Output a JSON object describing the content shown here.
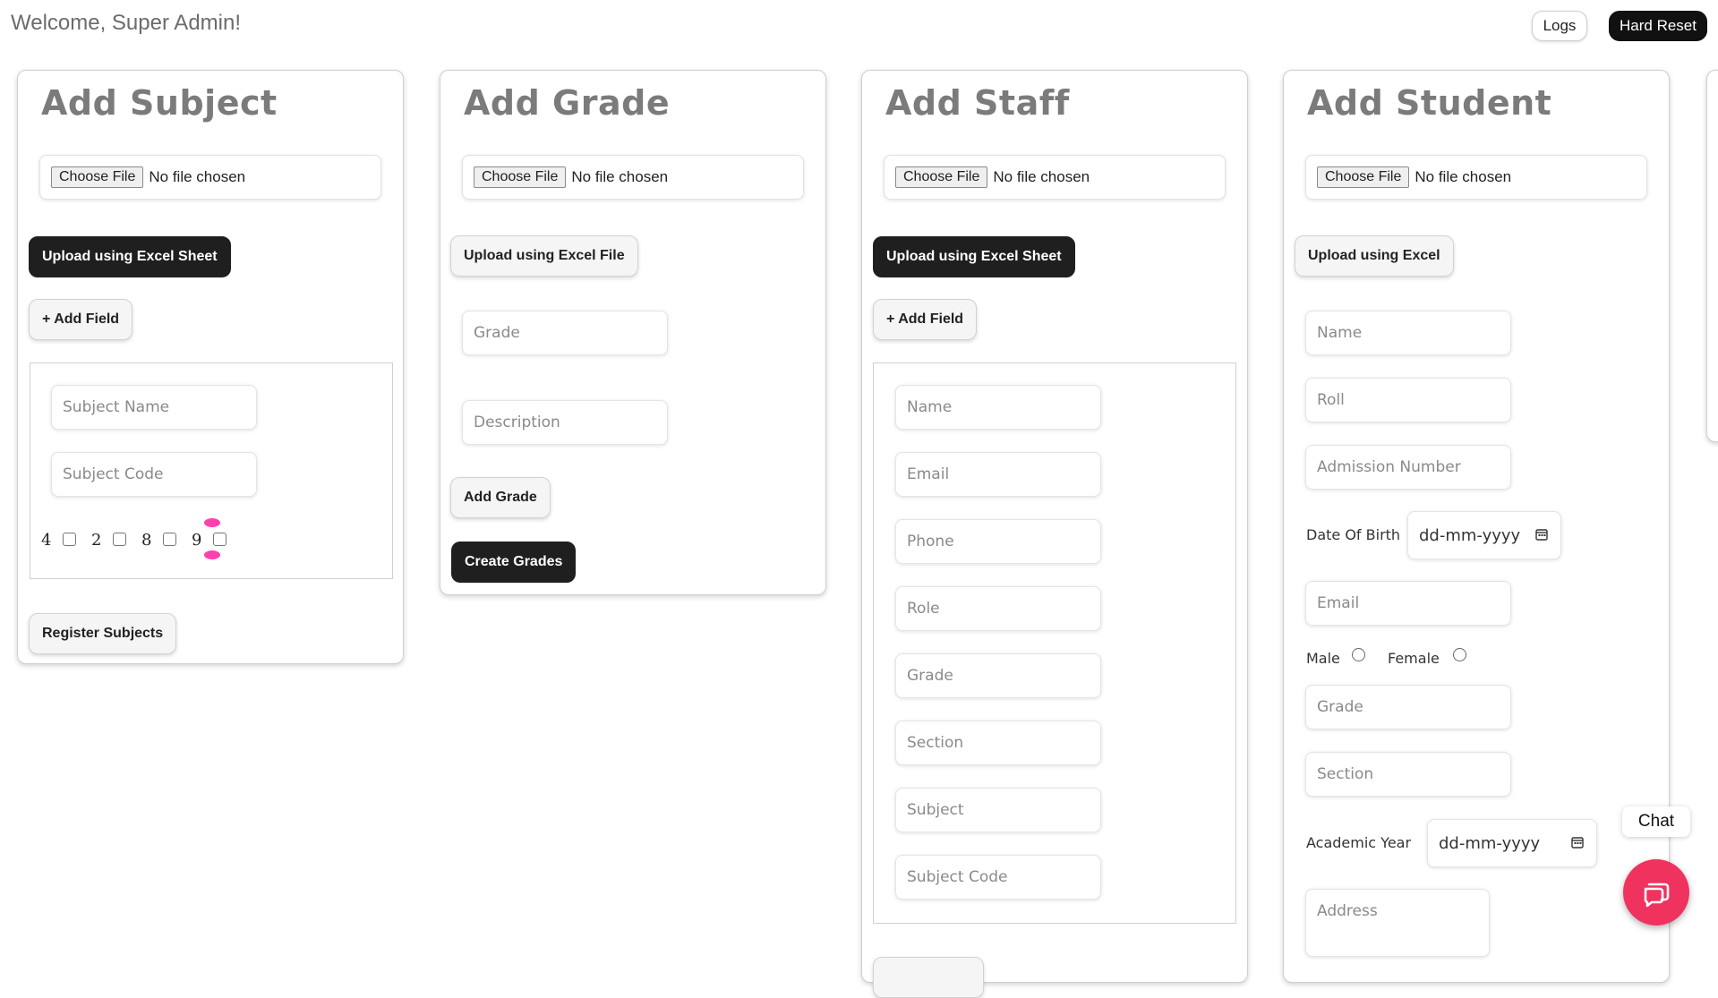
{
  "header": {
    "welcome": "Welcome, Super Admin!",
    "logs_label": "Logs",
    "hard_reset_label": "Hard Reset"
  },
  "file_input": {
    "choose_label": "Choose File",
    "no_file_label": "No file chosen"
  },
  "subject_card": {
    "title": "Add Subject",
    "upload_label": "Upload using Excel Sheet",
    "add_field_label": "+ Add Field",
    "subject_name_placeholder": "Subject Name",
    "subject_code_placeholder": "Subject Code",
    "grade_options": [
      "4",
      "2",
      "8",
      "9"
    ],
    "register_label": "Register Subjects"
  },
  "grade_card": {
    "title": "Add Grade",
    "upload_label": "Upload using Excel File",
    "grade_placeholder": "Grade",
    "description_placeholder": "Description",
    "add_grade_label": "Add Grade",
    "create_grades_label": "Create Grades"
  },
  "staff_card": {
    "title": "Add Staff",
    "upload_label": "Upload using Excel Sheet",
    "add_field_label": "+ Add Field",
    "fields": [
      "Name",
      "Email",
      "Phone",
      "Role",
      "Grade",
      "Section",
      "Subject",
      "Subject Code"
    ]
  },
  "student_card": {
    "title": "Add Student",
    "upload_label": "Upload using Excel",
    "name_placeholder": "Name",
    "roll_placeholder": "Roll",
    "admission_placeholder": "Admission Number",
    "dob_label": "Date Of Birth",
    "date_placeholder": "dd-mm-yyyy",
    "email_placeholder": "Email",
    "male_label": "Male",
    "female_label": "Female",
    "grade_placeholder": "Grade",
    "section_placeholder": "Section",
    "academic_year_label": "Academic Year",
    "address_placeholder": "Address"
  },
  "chat": {
    "label": "Chat"
  },
  "colors": {
    "dark_button": "#1f1f1f",
    "chat_accent": "#f0325e",
    "title_gray": "#7b7b7b"
  }
}
